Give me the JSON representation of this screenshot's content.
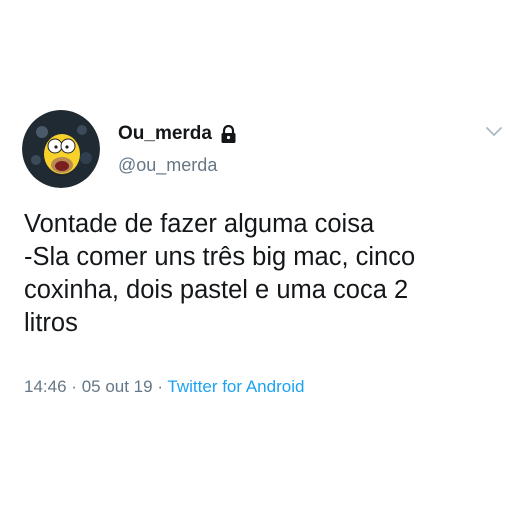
{
  "tweet": {
    "display_name": "Ou_merda",
    "handle": "@ou_merda",
    "text_lines": [
      "Vontade de fazer alguma coisa",
      "-Sla comer uns três big mac, cinco",
      "coxinha, dois pastel e uma coca 2",
      "litros"
    ],
    "time": "14:46",
    "separator": "·",
    "date": "05 out 19",
    "source": "Twitter for Android"
  },
  "icons": {
    "lock": "lock-icon",
    "menu": "chevron-down-icon",
    "avatar": "avatar"
  },
  "colors": {
    "text": "#14171a",
    "secondary": "#657786",
    "link": "#1da1f2",
    "background": "#ffffff"
  }
}
